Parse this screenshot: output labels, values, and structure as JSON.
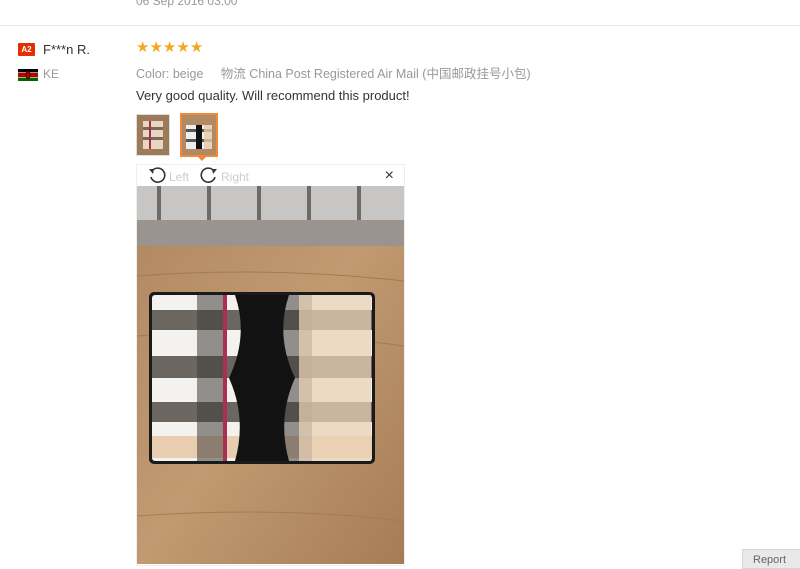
{
  "previous_review": {
    "date": "06 Sep 2016 03:00"
  },
  "review": {
    "badge": "A2",
    "username": "F***n R.",
    "country_code": "KE",
    "stars": 5,
    "color_label": "Color:",
    "color_value": "beige",
    "shipping_label": "物流",
    "shipping_value": "China Post Registered Air Mail (中国邮政挂号小包)",
    "comment": "Very good quality. Will recommend this product!"
  },
  "viewer": {
    "rotate_left_label": "Left",
    "rotate_right_label": "Right",
    "close_symbol": "×"
  },
  "colors": {
    "star": "#f5a623",
    "badge": "#e62e04",
    "active_thumb_border": "#f4883a"
  },
  "icons": [
    "rotate-left-icon",
    "rotate-right-icon",
    "close-icon",
    "star-icon",
    "kenya-flag-icon"
  ],
  "corner_button": {
    "label": "Report"
  }
}
